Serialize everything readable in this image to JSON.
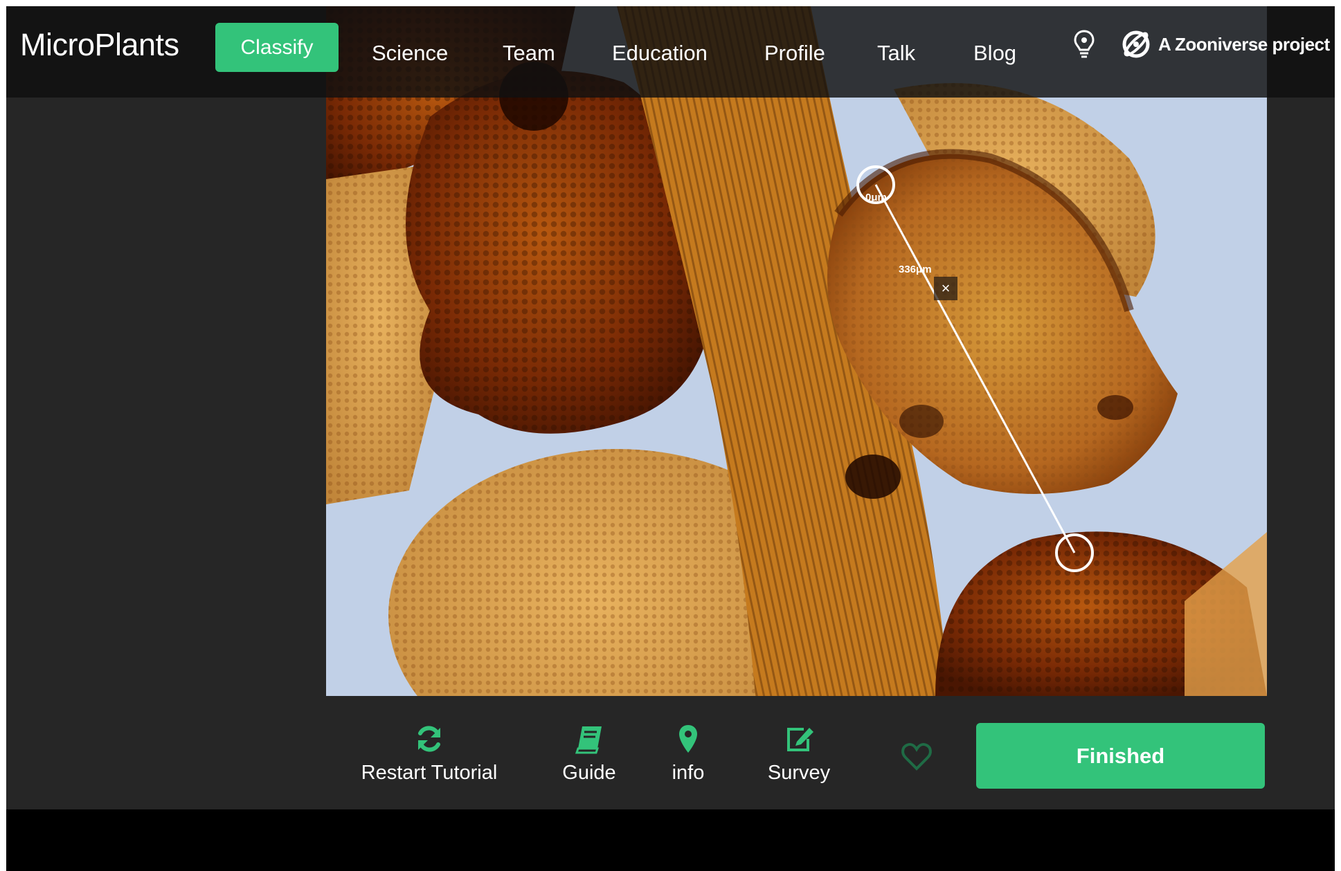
{
  "app": {
    "brand": "MicroPlants"
  },
  "nav": {
    "items": [
      {
        "label": "Classify",
        "active": true
      },
      {
        "label": "Science"
      },
      {
        "label": "Team"
      },
      {
        "label": "Education"
      },
      {
        "label": "Profile"
      },
      {
        "label": "Talk"
      },
      {
        "label": "Blog"
      }
    ],
    "zooniverse_label": "A Zooniverse project",
    "icons": [
      "lightbulb-icon",
      "zooniverse-logo-icon"
    ]
  },
  "measurement": {
    "start_label": "0μm",
    "end_label": "336μm",
    "remove_label": "×"
  },
  "toolbar": {
    "restart_tutorial": "Restart Tutorial",
    "guide": "Guide",
    "info": "info",
    "survey": "Survey",
    "finished": "Finished",
    "icons": [
      "refresh-icon",
      "book-icon",
      "map-pin-icon",
      "edit-icon",
      "heart-icon"
    ]
  },
  "colors": {
    "accent": "#33c37a",
    "nav_background": "#101010",
    "app_background": "#262626"
  }
}
